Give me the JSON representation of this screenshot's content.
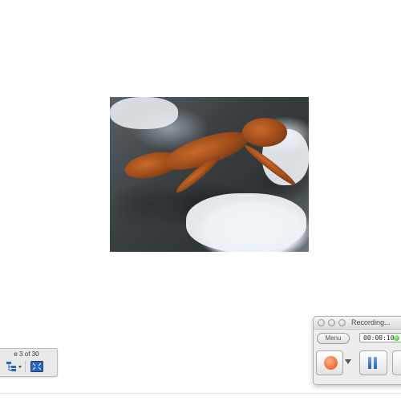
{
  "slide": {
    "counter_text": "e 3 of 30"
  },
  "slide_toolbar": {
    "icons": [
      "outline-icon",
      "screen-icon"
    ]
  },
  "recorder": {
    "title": "Recording...",
    "menu_label": "Menu",
    "timer": "00:00:10",
    "status_color": "#2ecc2e",
    "record_color": "#f06a3a",
    "pause_color": "#2a6fd6"
  }
}
